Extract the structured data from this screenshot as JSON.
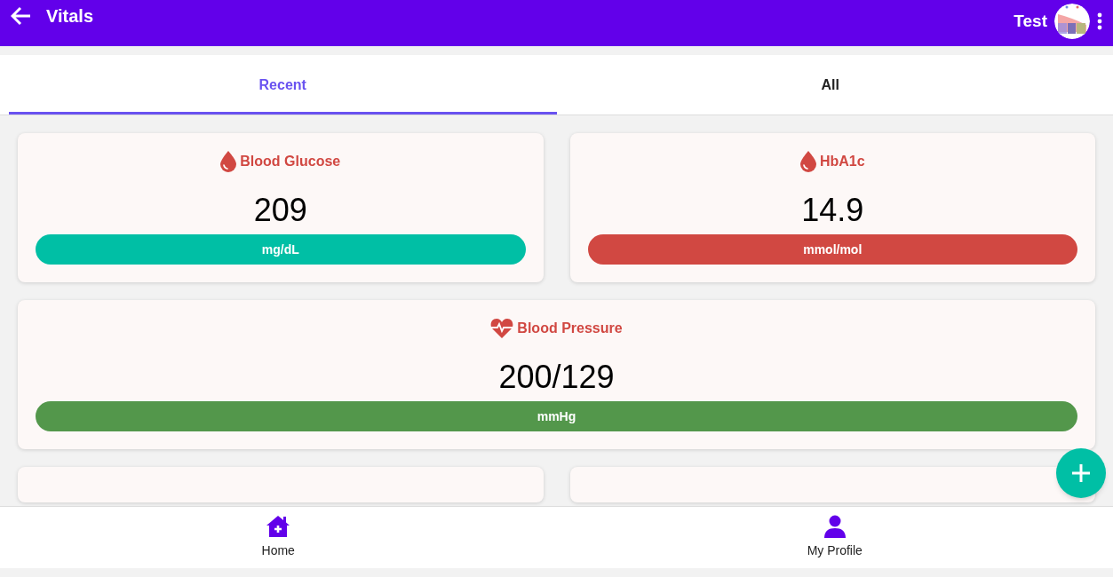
{
  "app_bar": {
    "title": "Vitals",
    "user_name": "Test"
  },
  "tabs": [
    {
      "label": "Recent",
      "selected": true
    },
    {
      "label": "All",
      "selected": false
    }
  ],
  "vitals": [
    {
      "kind": "drop",
      "name": "Blood Glucose",
      "value": "209",
      "unit": "mg/dL",
      "color": "#00bfa5",
      "wide": false
    },
    {
      "kind": "drop",
      "name": "HbA1c",
      "value": "14.9",
      "unit": "mmol/mol",
      "color": "#d14842",
      "wide": false
    },
    {
      "kind": "heart",
      "name": "Blood Pressure",
      "value": "200/129",
      "unit": "mmHg",
      "color": "#53974b",
      "wide": true
    }
  ],
  "bottom_nav": [
    {
      "kind": "home",
      "label": "Home"
    },
    {
      "kind": "person",
      "label": "My Profile"
    }
  ]
}
